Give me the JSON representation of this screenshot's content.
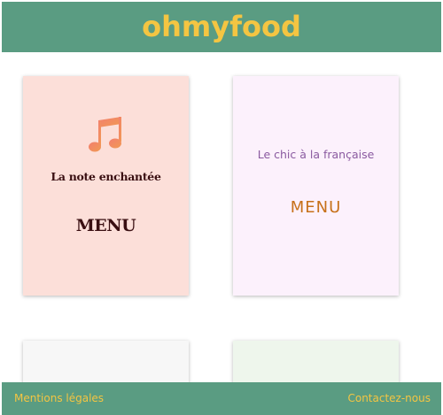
{
  "header": {
    "logo": "ohmyfood"
  },
  "cards": [
    {
      "name": "La note enchantée",
      "menu_label": "MENU",
      "icon": "music-note-icon"
    },
    {
      "name": "Le chic à la française",
      "menu_label": "MENU"
    },
    {},
    {}
  ],
  "footer": {
    "legal": "Mentions légales",
    "contact": "Contactez-nous"
  },
  "colors": {
    "header_bg": "#5a9c82",
    "logo_text": "#f4c542",
    "card1_bg": "#fcdfd9",
    "card2_bg": "#fcf1fc",
    "card3_bg": "#f7f7f7",
    "card4_bg": "#eef6ec",
    "card1_text": "#3a0f12",
    "card2_name": "#8a5aa0",
    "card2_menu": "#c7711a"
  }
}
